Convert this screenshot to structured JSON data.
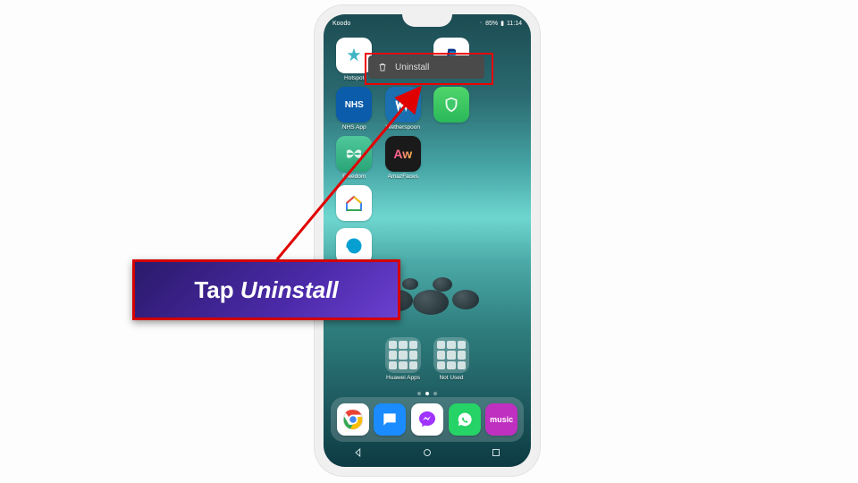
{
  "status": {
    "carrier": "Koodo",
    "battery": "85%",
    "time": "11:14"
  },
  "context_menu": {
    "label": "Uninstall"
  },
  "apps": {
    "r1": [
      {
        "label": "Hotspot"
      },
      {
        "label": ""
      },
      {
        "label": ""
      },
      {
        "label": ""
      }
    ],
    "r2": [
      {
        "label": "NHS App",
        "text": "NHS"
      },
      {
        "label": "Wetherspoon"
      },
      {
        "label": ""
      }
    ],
    "r3": [
      {
        "label": "Freedom"
      },
      {
        "label": "AmazFaces",
        "text": "Aw"
      }
    ],
    "r5": [
      {
        "label": "Amazon Alexa"
      }
    ]
  },
  "home_row4": {
    "label": ""
  },
  "folders": [
    {
      "label": "Huawei Apps"
    },
    {
      "label": "Not Used"
    }
  ],
  "dock": [
    {
      "name": "chrome"
    },
    {
      "name": "messages"
    },
    {
      "name": "messenger"
    },
    {
      "name": "whatsapp"
    },
    {
      "name": "music",
      "text": "music"
    }
  ],
  "callout": {
    "prefix": "Tap ",
    "emphasis": "Uninstall"
  }
}
